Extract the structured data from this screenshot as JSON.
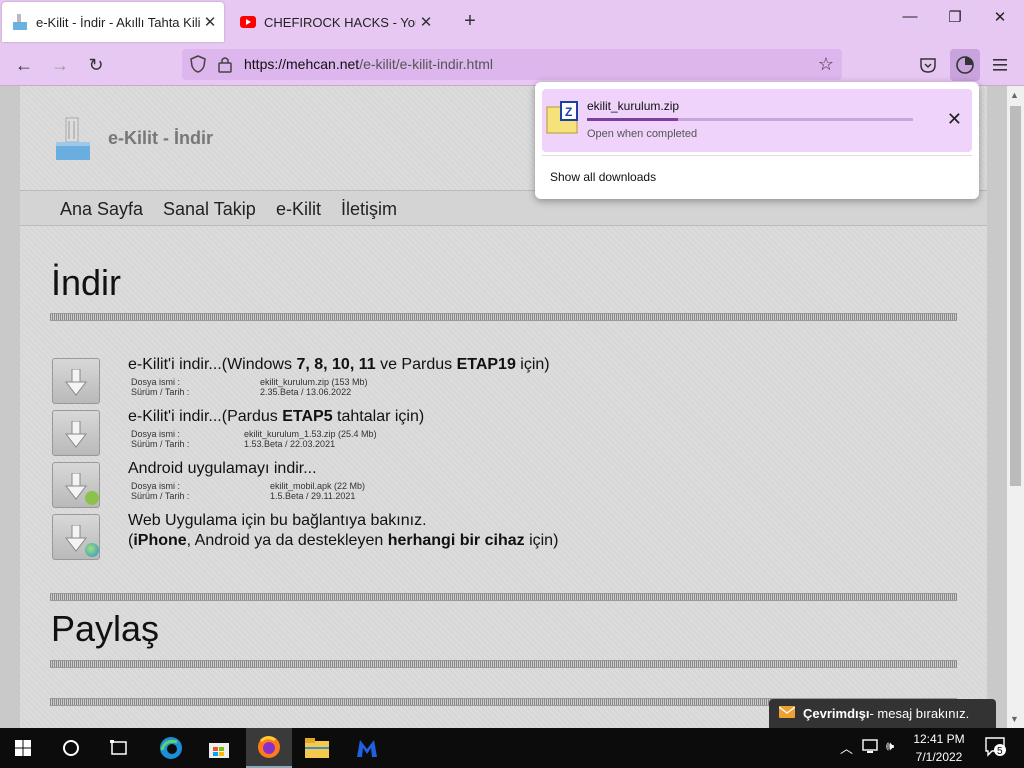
{
  "browser": {
    "tabs": [
      {
        "title": "e-Kilit - İndir - Akıllı Tahta Kilit P",
        "active": true
      },
      {
        "title": "CHEFIROCK HACKS - YouTube",
        "active": false
      }
    ],
    "url_host": "https://mehcan.net",
    "url_path": "/e-kilit/e-kilit-indir.html"
  },
  "downloads_panel": {
    "file_name": "ekilit_kurulum.zip",
    "status": "Open when completed",
    "progress": 0.28,
    "show_all_label": "Show all downloads"
  },
  "site": {
    "title": "e-Kilit - İndir",
    "menu": [
      "Ana Sayfa",
      "Sanal Takip",
      "e-Kilit",
      "İletişim"
    ],
    "section_download": "İndir",
    "section_share": "Paylaş",
    "meta_labels": {
      "file": "Dosya ismi :",
      "version": "Sürüm / Tarih :"
    },
    "downloads": [
      {
        "title_parts": [
          "e-Kilit'i indir...(Windows ",
          "7, 8, 10, 11",
          " ve Pardus ",
          "ETAP19",
          " için)"
        ],
        "file": "ekilit_kurulum.zip (153 Mb)",
        "version": "2.35.Beta / 13.06.2022"
      },
      {
        "title_parts": [
          "e-Kilit'i indir...(Pardus ",
          "ETAP5",
          " tahtalar için)"
        ],
        "file": "ekilit_kurulum_1.53.zip (25.4 Mb)",
        "version": "1.53.Beta / 22.03.2021"
      },
      {
        "title_parts": [
          "Android uygulamayı indir..."
        ],
        "file": "ekilit_mobil.apk (22 Mb)",
        "version": "1.5.Beta / 29.11.2021"
      },
      {
        "title_parts": [
          "Web Uygulama için bu bağlantıya bakınız."
        ],
        "line2_parts": [
          "(",
          "iPhone",
          ", Android ya da destekleyen ",
          "herhangi bir cihaz",
          " için)"
        ]
      }
    ]
  },
  "chat_widget": {
    "status": "Çevrimdışı",
    "message": " - mesaj bırakınız."
  },
  "taskbar": {
    "time": "12:41 PM",
    "date": "7/1/2022",
    "notifications": "5"
  }
}
